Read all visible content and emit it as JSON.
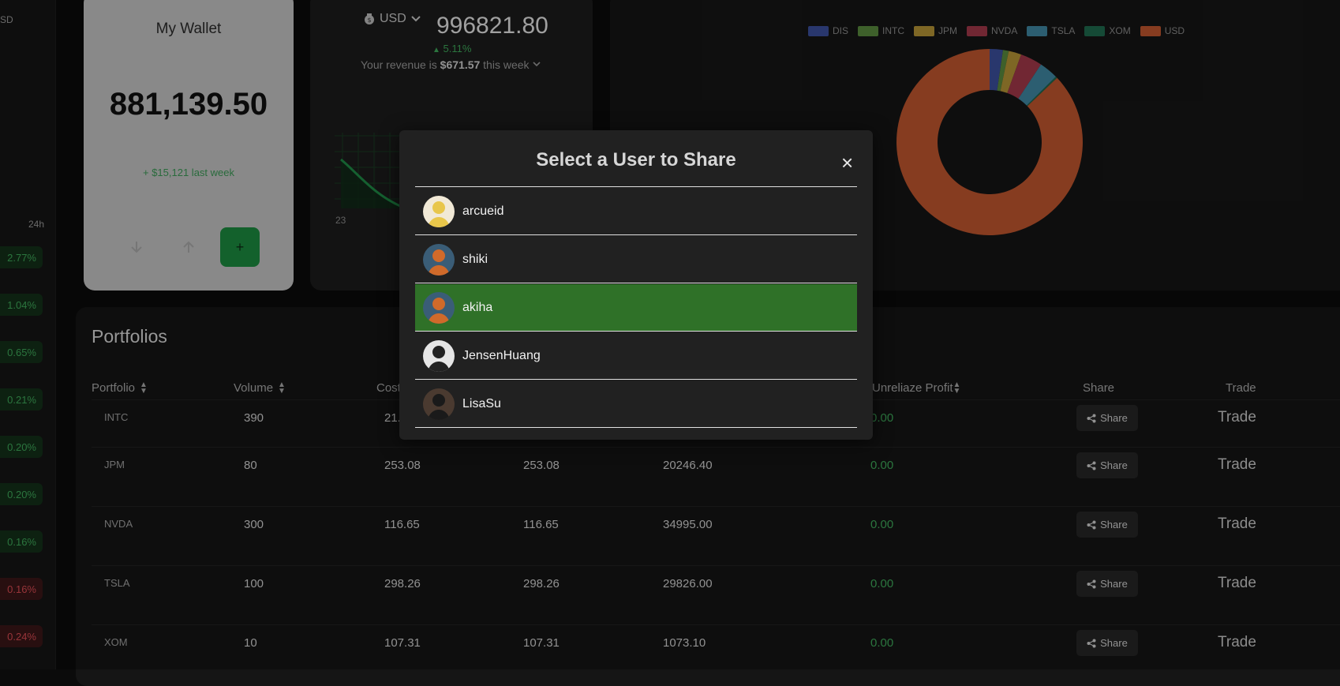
{
  "sidebar": {
    "currency_label": "SD",
    "period_label": "24h",
    "changes": [
      {
        "value": "2.77%",
        "trend": "up"
      },
      {
        "value": "1.04%",
        "trend": "up"
      },
      {
        "value": "0.65%",
        "trend": "up"
      },
      {
        "value": "0.21%",
        "trend": "up"
      },
      {
        "value": "0.20%",
        "trend": "up"
      },
      {
        "value": "0.20%",
        "trend": "up"
      },
      {
        "value": "0.16%",
        "trend": "up"
      },
      {
        "value": "0.16%",
        "trend": "down"
      },
      {
        "value": "0.24%",
        "trend": "down"
      }
    ]
  },
  "wallet": {
    "title": "My Wallet",
    "amount": "881,139.50",
    "weekly_change": "+ $15,121 last week",
    "withdraw_icon": "arrow-down-icon",
    "deposit_icon": "arrow-up-icon",
    "add_label": "+"
  },
  "revenue": {
    "currency": "USD",
    "value": "996821.80",
    "change": "5.11%",
    "text_prefix": "Your revenue is",
    "amount": "$671.57",
    "period": "this week",
    "x_label": "23"
  },
  "allocation": {
    "legend": [
      {
        "name": "DIS",
        "color": "#3b4f9c"
      },
      {
        "name": "INTC",
        "color": "#5a8a3e"
      },
      {
        "name": "JPM",
        "color": "#b59436"
      },
      {
        "name": "NVDA",
        "color": "#a3394a"
      },
      {
        "name": "TSLA",
        "color": "#3f87a3"
      },
      {
        "name": "XOM",
        "color": "#1f6b4e"
      },
      {
        "name": "USD",
        "color": "#c0562f"
      }
    ],
    "slices": [
      {
        "name": "DIS",
        "fraction": 0.023
      },
      {
        "name": "INTC",
        "fraction": 0.01
      },
      {
        "name": "JPM",
        "fraction": 0.022
      },
      {
        "name": "NVDA",
        "fraction": 0.038
      },
      {
        "name": "TSLA",
        "fraction": 0.033
      },
      {
        "name": "XOM",
        "fraction": 0.003
      },
      {
        "name": "USD",
        "fraction": 0.871
      }
    ]
  },
  "portfolios": {
    "title": "Portfolios",
    "columns": {
      "portfolio": "Portfolio",
      "volume": "Volume",
      "cost": "Cost",
      "unrealized": "Unreliaze Profit",
      "share": "Share",
      "trade": "Trade"
    },
    "rows": [
      {
        "symbol": "INTC",
        "volume": "390",
        "cost": "21.",
        "price": "",
        "value": "",
        "profit": "0.00"
      },
      {
        "symbol": "JPM",
        "volume": "80",
        "cost": "253.08",
        "price": "253.08",
        "value": "20246.40",
        "profit": "0.00"
      },
      {
        "symbol": "NVDA",
        "volume": "300",
        "cost": "116.65",
        "price": "116.65",
        "value": "34995.00",
        "profit": "0.00"
      },
      {
        "symbol": "TSLA",
        "volume": "100",
        "cost": "298.26",
        "price": "298.26",
        "value": "29826.00",
        "profit": "0.00"
      },
      {
        "symbol": "XOM",
        "volume": "10",
        "cost": "107.31",
        "price": "107.31",
        "value": "1073.10",
        "profit": "0.00"
      }
    ],
    "share_label": "Share",
    "trade_label": "Trade"
  },
  "modal": {
    "title": "Select a User to Share",
    "close_label": "×",
    "users": [
      {
        "name": "arcueid",
        "selected": false
      },
      {
        "name": "shiki",
        "selected": false
      },
      {
        "name": "akiha",
        "selected": true
      },
      {
        "name": "JensenHuang",
        "selected": false
      },
      {
        "name": "LisaSu",
        "selected": false
      }
    ]
  }
}
